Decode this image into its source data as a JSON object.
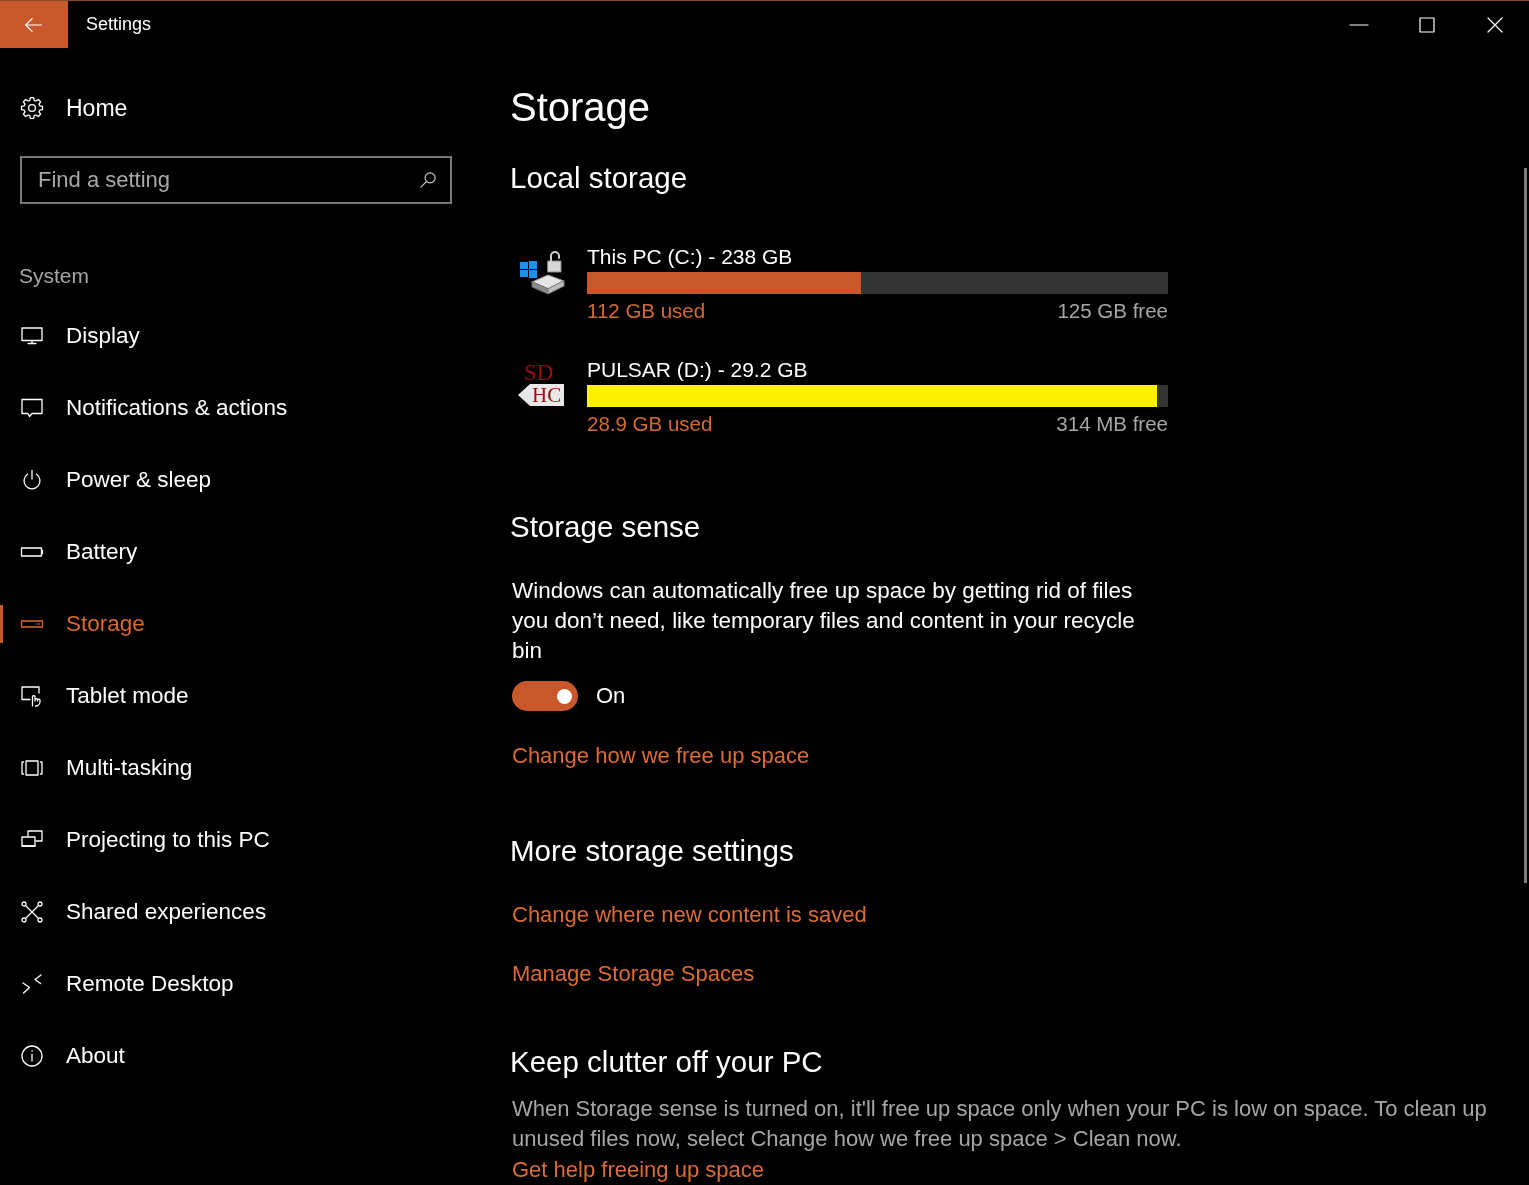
{
  "window": {
    "title": "Settings"
  },
  "sidebar": {
    "home": {
      "label": "Home"
    },
    "search": {
      "placeholder": "Find a setting"
    },
    "section": "System",
    "items": [
      {
        "label": "Display",
        "selected": false
      },
      {
        "label": "Notifications & actions",
        "selected": false
      },
      {
        "label": "Power & sleep",
        "selected": false
      },
      {
        "label": "Battery",
        "selected": false
      },
      {
        "label": "Storage",
        "selected": true
      },
      {
        "label": "Tablet mode",
        "selected": false
      },
      {
        "label": "Multi-tasking",
        "selected": false
      },
      {
        "label": "Projecting to this PC",
        "selected": false
      },
      {
        "label": "Shared experiences",
        "selected": false
      },
      {
        "label": "Remote Desktop",
        "selected": false
      },
      {
        "label": "About",
        "selected": false
      }
    ]
  },
  "page": {
    "title": "Storage",
    "local_storage": {
      "heading": "Local storage",
      "drives": [
        {
          "kind": "system",
          "name": "This PC (C:) - 238 GB",
          "level": 0.472,
          "color": "#c8582a",
          "used": "112 GB used",
          "free": "125 GB free"
        },
        {
          "kind": "sd",
          "icon_text": [
            "SD",
            "HC"
          ],
          "name": "PULSAR (D:) - 29.2 GB",
          "level": 0.981,
          "color": "#fff000",
          "used": "28.9 GB used",
          "free": "314 MB free"
        }
      ]
    },
    "storage_sense": {
      "heading": "Storage sense",
      "description": "Windows can automatically free up space by getting rid of files you don’t need, like temporary files and content in your recycle bin",
      "toggle": {
        "on": true,
        "label": "On"
      },
      "link": "Change how we free up space"
    },
    "more_settings": {
      "heading": "More storage settings",
      "links": [
        "Change where new content is saved",
        "Manage Storage Spaces"
      ]
    },
    "clutter": {
      "heading": "Keep clutter off your PC",
      "description": "When Storage sense is turned on, it'll free up space only when your PC is low on space. To clean up unused files now, select Change how we free up space > Clean now.",
      "link": "Get help freeing up space"
    }
  }
}
